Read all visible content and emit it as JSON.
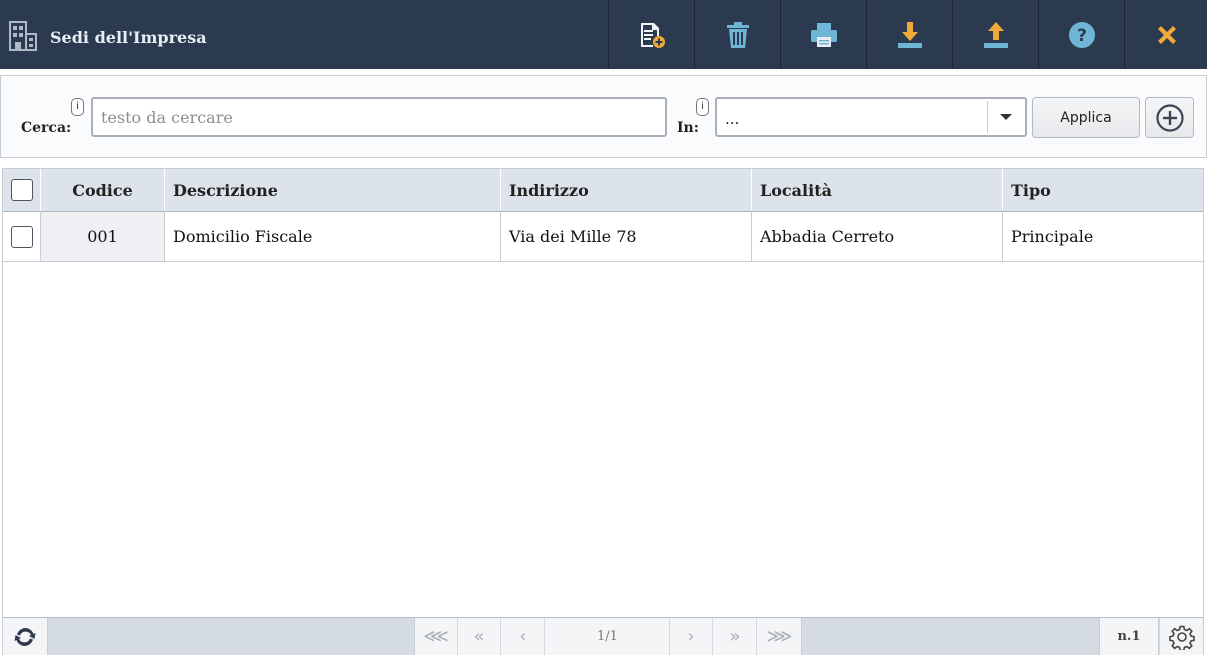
{
  "window": {
    "title": "Sedi dell'Impresa",
    "brand_icon": "building-icon",
    "toolbar": [
      {
        "name": "new-record-button",
        "icon": "document-add-icon",
        "color": "#f2f4f7"
      },
      {
        "name": "delete-button",
        "icon": "trash-icon",
        "color": "#6fb6d6"
      },
      {
        "name": "print-button",
        "icon": "printer-icon",
        "color": "#6fb6d6"
      },
      {
        "name": "export-button",
        "icon": "download-icon",
        "color": "#f0a93b"
      },
      {
        "name": "import-button",
        "icon": "upload-icon",
        "color": "#f0a93b"
      },
      {
        "name": "help-button",
        "icon": "help-icon",
        "color": "#6fb6d6"
      },
      {
        "name": "close-button",
        "icon": "close-icon",
        "color": "#f0a93b"
      }
    ]
  },
  "search": {
    "label": "Cerca:",
    "info": "i",
    "placeholder": "testo da cercare",
    "value": "",
    "in_label": "In:",
    "in_info": "i",
    "in_value": "...",
    "apply_label": "Applica"
  },
  "table": {
    "columns": [
      "Codice",
      "Descrizione",
      "Indirizzo",
      "Località",
      "Tipo"
    ],
    "rows": [
      {
        "codice": "001",
        "descrizione": "Domicilio Fiscale",
        "indirizzo": "Via dei Mille 78",
        "localita": "Abbadia Cerreto",
        "tipo": "Principale"
      }
    ]
  },
  "footer": {
    "page_indicator": "1/1",
    "record_count": "n.1"
  },
  "colors": {
    "header_bg": "#2c3a4f",
    "title": "#e8eef6",
    "accent_blue": "#6fb6d6",
    "accent_orange": "#f0a93b"
  }
}
